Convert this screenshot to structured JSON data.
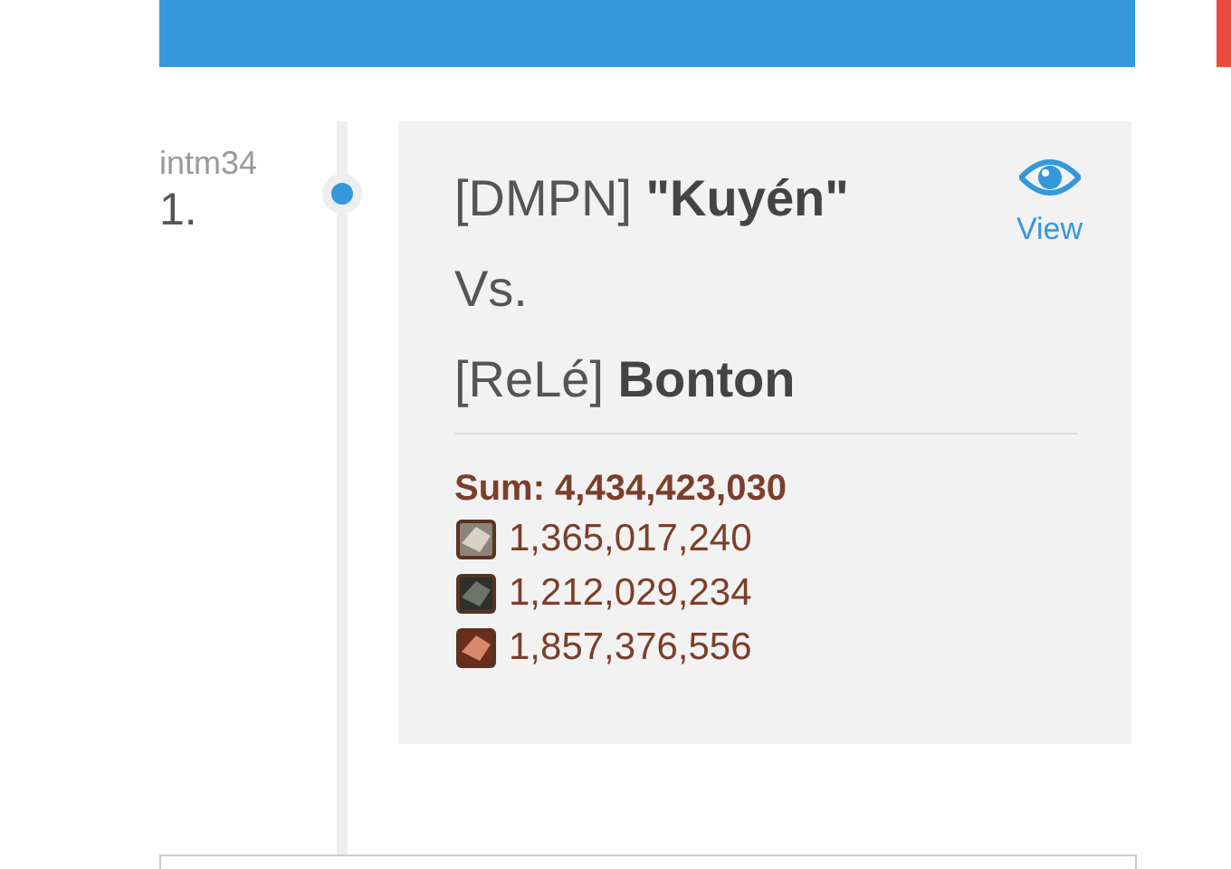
{
  "entry": {
    "user": "intm34",
    "rank": "1.",
    "attacker": {
      "tag": "[DMPN]",
      "name": "\"Kuyén\""
    },
    "versus": "Vs.",
    "defender": {
      "tag": "[ReLé]",
      "name": "Bonton"
    },
    "view": "View",
    "sum": "Sum: 4,434,423,030",
    "resources": [
      {
        "kind": "stone",
        "amount": "1,365,017,240"
      },
      {
        "kind": "ore",
        "amount": "1,212,029,234"
      },
      {
        "kind": "food",
        "amount": "1,857,376,556"
      }
    ]
  }
}
